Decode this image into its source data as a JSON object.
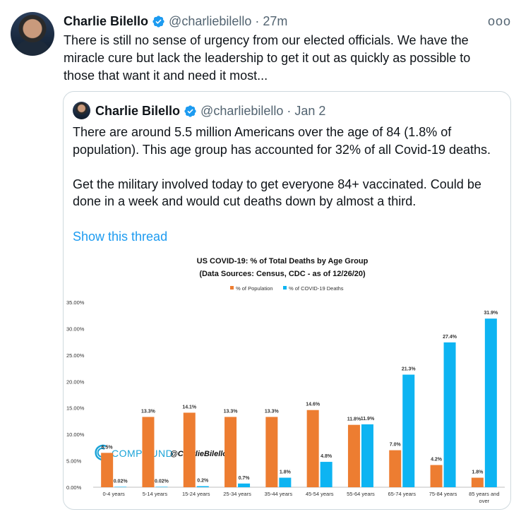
{
  "tweet": {
    "author_name": "Charlie Bilello",
    "handle": "@charliebilello",
    "separator": "·",
    "time": "27m",
    "more_label": "ooo",
    "text": "There is still no sense of urgency from our elected officials. We have the miracle cure but lack the leadership to get it out as quickly as possible to those that want it and need it most..."
  },
  "quote": {
    "author_name": "Charlie Bilello",
    "handle": "@charliebilello",
    "separator": "·",
    "date": "Jan 2",
    "paragraph1": "There are around 5.5 million Americans over the age of 84 (1.8% of population). This age group has accounted for 32% of all Covid-19 deaths.",
    "paragraph2": "Get the military involved today to get everyone 84+ vaccinated. Could be done in a week and would cut deaths down by almost a third.",
    "show_thread": "Show this thread"
  },
  "colors": {
    "population": "#ED7D31",
    "deaths": "#0DB4F2",
    "link": "#1d9bf0",
    "verified": "#1d9bf0",
    "compound": "#1aa3d8"
  },
  "chart_data": {
    "type": "bar",
    "title": "US COVID-19: % of Total Deaths by Age Group",
    "subtitle": "(Data Sources: Census, CDC - as of 12/26/20)",
    "categories": [
      "0-4 years",
      "5-14 years",
      "15-24 years",
      "25-34 years",
      "35-44 years",
      "45-54 years",
      "55-64 years",
      "65-74 years",
      "75-84 years",
      "85 years and over"
    ],
    "series": [
      {
        "name": "% of Population",
        "values": [
          6.5,
          13.3,
          14.1,
          13.3,
          13.3,
          14.6,
          11.8,
          7.0,
          4.2,
          1.8
        ],
        "labels": [
          "6.5%",
          "13.3%",
          "14.1%",
          "13.3%",
          "13.3%",
          "14.6%",
          "11.8%",
          "7.0%",
          "4.2%",
          "1.8%"
        ]
      },
      {
        "name": "% of COVID-19 Deaths",
        "values": [
          0.02,
          0.02,
          0.2,
          0.7,
          1.8,
          4.8,
          11.9,
          21.3,
          27.4,
          31.9
        ],
        "labels": [
          "0.02%",
          "0.02%",
          "0.2%",
          "0.7%",
          "1.8%",
          "4.8%",
          "11.9%",
          "21.3%",
          "27.4%",
          "31.9%"
        ]
      }
    ],
    "ylim": [
      0,
      35
    ],
    "yticks": [
      "0.00%",
      "5.00%",
      "10.00%",
      "15.00%",
      "20.00%",
      "25.00%",
      "30.00%",
      "35.00%"
    ],
    "legend_position": "top-center",
    "watermark": {
      "brand": "COMPOUND",
      "handle": "@CharlieBilello"
    }
  }
}
